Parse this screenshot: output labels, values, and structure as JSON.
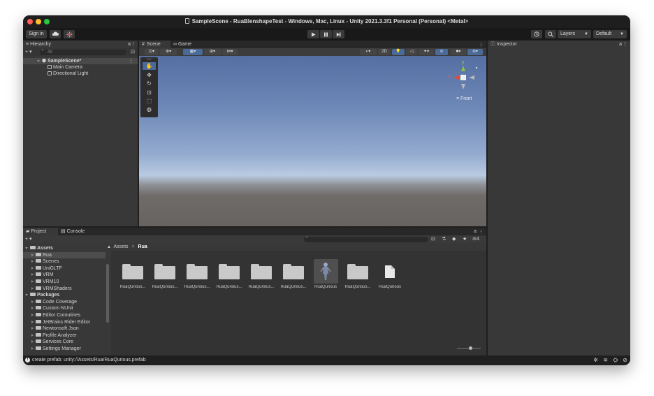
{
  "window": {
    "title": "SampleScene - RuaBlenshapeTest - Windows, Mac, Linux - Unity 2021.3.3f1 Personal (Personal) <Metal>",
    "traffic_light_colors": [
      "#ff5f57",
      "#febc2e",
      "#28c840"
    ]
  },
  "toolbar": {
    "sign_in_label": "Sign in",
    "cloud_icon": "cloud-icon",
    "collab_icon": "collab-icon",
    "play_icon": "play-icon",
    "pause_icon": "pause-icon",
    "step_icon": "step-icon",
    "history_icon": "history-icon",
    "search_icon": "search-icon",
    "layers_label": "Layers",
    "layout_label": "Default"
  },
  "hierarchy": {
    "tab_label": "Hierarchy",
    "add_label": "+ ▾",
    "search_placeholder": "All",
    "scene_name": "SampleScene*",
    "items": [
      "Main Camera",
      "Directional Light"
    ]
  },
  "scene_view": {
    "tabs": [
      "Scene",
      "Game"
    ],
    "mode_2d_label": "2D",
    "gizmo": {
      "axis_y": "y",
      "axis_x": "x",
      "view_label": "≡ Front"
    },
    "sky_top_color": "#5a73a7",
    "sky_horizon_color": "#b6c9e2",
    "ground_color": "#696562"
  },
  "inspector": {
    "tab_label": "Inspector"
  },
  "project": {
    "tabs": [
      "Project",
      "Console"
    ],
    "add_label": "+ ▾",
    "hidden_count": "4",
    "breadcrumb": [
      "Assets",
      "Rua"
    ],
    "tree": [
      {
        "label": "Assets",
        "level": 0,
        "open": true
      },
      {
        "label": "Rua",
        "level": 1,
        "selected": true
      },
      {
        "label": "Scenes",
        "level": 1
      },
      {
        "label": "UniGLTF",
        "level": 1
      },
      {
        "label": "VRM",
        "level": 1
      },
      {
        "label": "VRM10",
        "level": 1
      },
      {
        "label": "VRMShaders",
        "level": 1
      },
      {
        "label": "Packages",
        "level": 0,
        "open": true
      },
      {
        "label": "Code Coverage",
        "level": 1
      },
      {
        "label": "Custom NUnit",
        "level": 1
      },
      {
        "label": "Editor Coroutines",
        "level": 1
      },
      {
        "label": "JetBrains Rider Editor",
        "level": 1
      },
      {
        "label": "Newtonsoft Json",
        "level": 1
      },
      {
        "label": "Profile Analyzer",
        "level": 1
      },
      {
        "label": "Services Core",
        "level": 1
      },
      {
        "label": "Settings Manager",
        "level": 1
      }
    ],
    "assets": [
      {
        "label": "RuaQurious...",
        "kind": "folder"
      },
      {
        "label": "RuaQurious...",
        "kind": "folder"
      },
      {
        "label": "RuaQurious...",
        "kind": "folder"
      },
      {
        "label": "RuaQurious...",
        "kind": "folder"
      },
      {
        "label": "RuaQurious...",
        "kind": "folder"
      },
      {
        "label": "RuaQurious...",
        "kind": "folder"
      },
      {
        "label": "RuaQurious",
        "kind": "prefab"
      },
      {
        "label": "RuaQurious...",
        "kind": "folder"
      },
      {
        "label": "RuaQurious",
        "kind": "file"
      }
    ]
  },
  "status": {
    "message": "create prefab: unity://Assets/Rua/RuaQurious.prefab"
  }
}
